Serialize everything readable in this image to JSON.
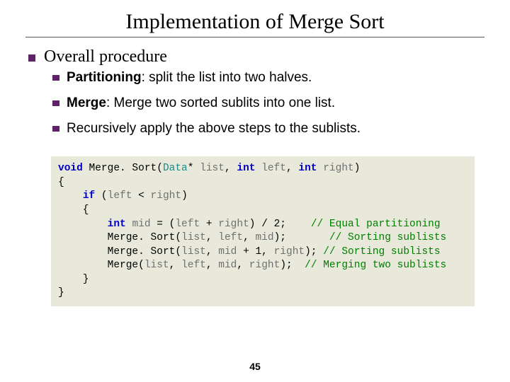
{
  "title": "Implementation of Merge Sort",
  "lvl1": "Overall procedure",
  "bullets": [
    {
      "bold": "Partitioning",
      "rest": ": split the list into two halves."
    },
    {
      "bold": "Merge",
      "rest": ": Merge two sorted sublits into one list."
    },
    {
      "bold": "",
      "rest": "Recursively apply the above steps to the sublists."
    }
  ],
  "code": {
    "l1": {
      "kw1": "void",
      "fn": " Merge. Sort(",
      "typ": "Data",
      "star": "* ",
      "v1": "list",
      "c1": ", ",
      "kw2": "int",
      "sp1": " ",
      "v2": "left",
      "c2": ", ",
      "kw3": "int",
      "sp2": " ",
      "v3": "right",
      "end": ")"
    },
    "l2": "{",
    "l3": {
      "pad": "    ",
      "kw": "if",
      "open": " (",
      "a": "left",
      "op": " < ",
      "b": "right",
      "close": ")"
    },
    "l4": "    {",
    "l5": {
      "pad": "        ",
      "kw": "int",
      "sp": " ",
      "v": "mid",
      "eq": " = (",
      "a": "left",
      "op": " + ",
      "b": "right",
      "tail": ") / 2;    ",
      "cmt": "// Equal partitioning"
    },
    "l6": {
      "pad": "        ",
      "call": "Merge. Sort(",
      "a": "list",
      "c1": ", ",
      "b": "left",
      "c2": ", ",
      "c": "mid",
      "end": ");       ",
      "cmt": "// Sorting sublists"
    },
    "l7": {
      "pad": "        ",
      "call": "Merge. Sort(",
      "a": "list",
      "c1": ", ",
      "b": "mid",
      "c2": " + 1, ",
      "c": "right",
      "end": "); ",
      "cmt": "// Sorting sublists"
    },
    "l8": {
      "pad": "        ",
      "call": "Merge(",
      "a": "list",
      "c1": ", ",
      "b": "left",
      "c2": ", ",
      "c": "mid",
      "c3": ", ",
      "d": "right",
      "end": ");  ",
      "cmt": "// Merging two sublists"
    },
    "l9": "    }",
    "l10": "}"
  },
  "page": "45"
}
